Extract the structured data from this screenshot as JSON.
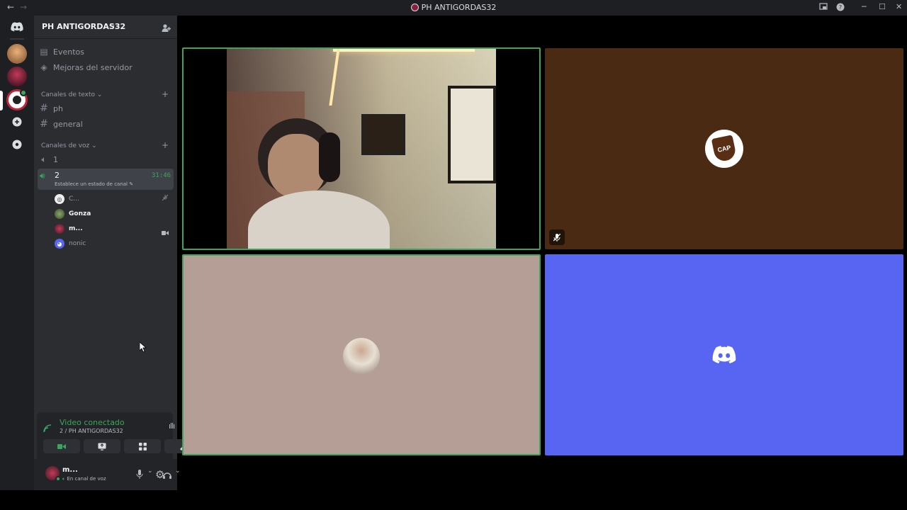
{
  "window": {
    "title": "PH ANTIGORDAS32",
    "back_icon": "←",
    "forward_icon": "→",
    "controls": [
      "inbox-icon",
      "help-icon",
      "minimize",
      "maximize",
      "close"
    ]
  },
  "rail": {
    "items": [
      "discord-home",
      "server-1",
      "server-2",
      "server-ph-antigordas32",
      "add-server",
      "explore"
    ]
  },
  "sidebar": {
    "server_name": "PH ANTIGORDAS32",
    "top_items": [
      {
        "label": "Eventos",
        "icon": "calendar-icon"
      },
      {
        "label": "Mejoras del servidor",
        "icon": "boost-icon"
      }
    ],
    "text_category": "Canales de texto",
    "text_channels": [
      "ph",
      "general"
    ],
    "voice_category": "Canales de voz",
    "voice_channels": [
      {
        "name": "1"
      },
      {
        "name": "2",
        "timer": "31:46",
        "status": "Establece un estado de canal"
      }
    ],
    "voice_users": [
      {
        "name": "C...",
        "muted": true
      },
      {
        "name": "Gonza"
      },
      {
        "name": "m...",
        "video": true
      },
      {
        "name": "nonic"
      }
    ]
  },
  "voice_panel": {
    "status": "Video conectado",
    "channel": "2 / PH ANTIGORDAS32",
    "buttons": [
      "camera",
      "screen-share",
      "activities",
      "soundboard"
    ]
  },
  "user_panel": {
    "name": "m...",
    "status": "En canal de voz"
  },
  "tiles": [
    {
      "type": "video",
      "speaking": true
    },
    {
      "type": "avatar",
      "bg": "#4a2a12",
      "avatar_text": "CAP",
      "muted": true
    },
    {
      "type": "avatar",
      "bg": "#b59e96",
      "speaking": true
    },
    {
      "type": "avatar",
      "bg": "#5865f2"
    }
  ],
  "colors": {
    "green": "#3ba55c",
    "discord_blurple": "#5865f2",
    "brown_tile": "#4a2a12",
    "pink_tile": "#b59e96"
  }
}
